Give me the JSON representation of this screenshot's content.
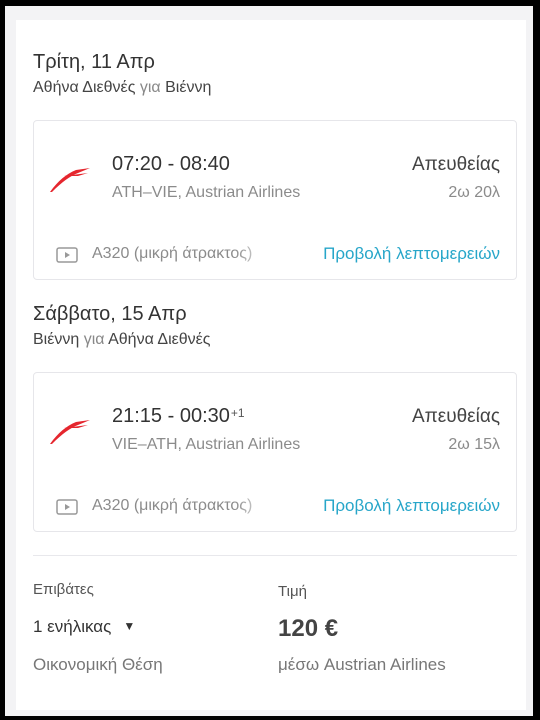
{
  "outbound": {
    "date": "Τρίτη, 11 Απρ",
    "route_from": "Αθήνα Διεθνές",
    "route_conn": "για",
    "route_to": "Βιέννη",
    "times": "07:20 - 08:40",
    "day_offset": "",
    "codes_airline": "ATH–VIE, Austrian Airlines",
    "stops": "Απευθείας",
    "duration": "2ω 20λ",
    "aircraft": "A320 (μικρή άτρακτος)",
    "details_link": "Προβολή λεπτομερειών",
    "airline_icon": "austrian-airlines-logo",
    "media_icon": "video-icon"
  },
  "inbound": {
    "date": "Σάββατο, 15 Απρ",
    "route_from": "Βιέννη",
    "route_conn": "για",
    "route_to": "Αθήνα Διεθνές",
    "times": "21:15 - 00:30",
    "day_offset": "+1",
    "codes_airline": "VIE–ATH, Austrian Airlines",
    "stops": "Απευθείας",
    "duration": "2ω 15λ",
    "aircraft": "A320 (μικρή άτρακτος)",
    "details_link": "Προβολή λεπτομερειών",
    "airline_icon": "austrian-airlines-logo",
    "media_icon": "video-icon"
  },
  "summary": {
    "passengers_label": "Επιβάτες",
    "passengers_value": "1 ενήλικας",
    "cabin": "Οικονομική Θέση",
    "price_label": "Τιμή",
    "price": "120 €",
    "via": "μέσω Austrian Airlines"
  },
  "colors": {
    "link": "#27a6c9",
    "airline_red": "#e5262e",
    "text_primary": "#333333",
    "text_secondary": "#8b8b8b"
  }
}
